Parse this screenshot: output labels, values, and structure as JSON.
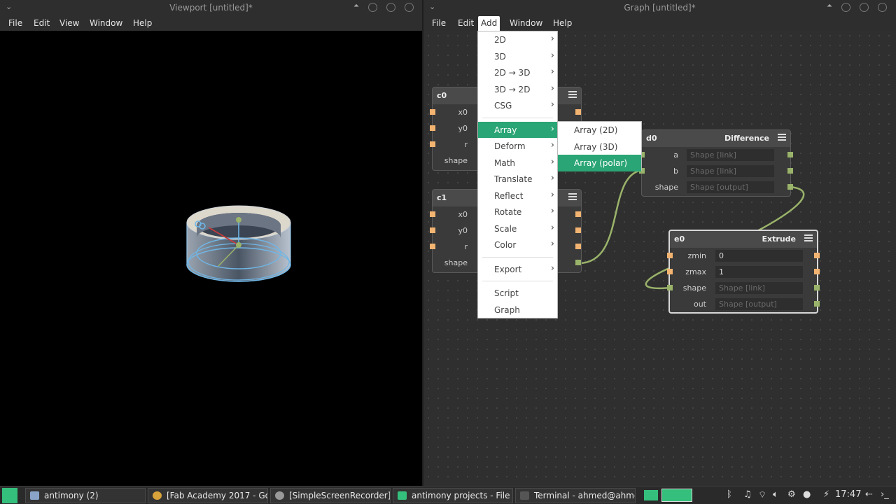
{
  "viewport": {
    "title": "Viewport [untitled]*",
    "menu": [
      "File",
      "Edit",
      "View",
      "Window",
      "Help"
    ]
  },
  "graph": {
    "title": "Graph [untitled]*",
    "menu": [
      "File",
      "Edit",
      "Add",
      "Window",
      "Help"
    ],
    "nodes": {
      "c0": {
        "name": "c0",
        "ports": [
          "x0",
          "y0",
          "r",
          "shape"
        ]
      },
      "c1": {
        "name": "c1",
        "ports": [
          "x0",
          "y0",
          "r",
          "shape"
        ]
      },
      "d0": {
        "name": "d0",
        "type": "Difference",
        "rows": [
          {
            "label": "a",
            "value": "Shape [link]"
          },
          {
            "label": "b",
            "value": "Shape [link]"
          },
          {
            "label": "shape",
            "value": "Shape [output]"
          }
        ]
      },
      "e0": {
        "name": "e0",
        "type": "Extrude",
        "rows": [
          {
            "label": "zmin",
            "value": "0"
          },
          {
            "label": "zmax",
            "value": "1"
          },
          {
            "label": "shape",
            "value": "Shape [link]"
          },
          {
            "label": "out",
            "value": "Shape [output]"
          }
        ]
      }
    }
  },
  "add_menu": {
    "items": [
      "2D",
      "3D",
      "2D → 3D",
      "3D → 2D",
      "CSG",
      "Array",
      "Deform",
      "Math",
      "Translate",
      "Reflect",
      "Rotate",
      "Scale",
      "Color",
      "Export",
      "Script",
      "Graph"
    ],
    "highlighted": "Array"
  },
  "array_submenu": {
    "items": [
      "Array (2D)",
      "Array (3D)",
      "Array (polar)"
    ],
    "highlighted": "Array (polar)"
  },
  "taskbar": {
    "tasks": [
      "antimony (2)",
      "[Fab Academy 2017 - Go...",
      "[SimpleScreenRecorder]",
      "antimony projects - File ...",
      "Terminal - ahmed@ahme..."
    ],
    "clock": "17:47"
  },
  "colors": {
    "accent": "#2aa575",
    "port_orange": "#f4b471",
    "port_green": "#9ab36a",
    "wire": "#9ab36a"
  }
}
